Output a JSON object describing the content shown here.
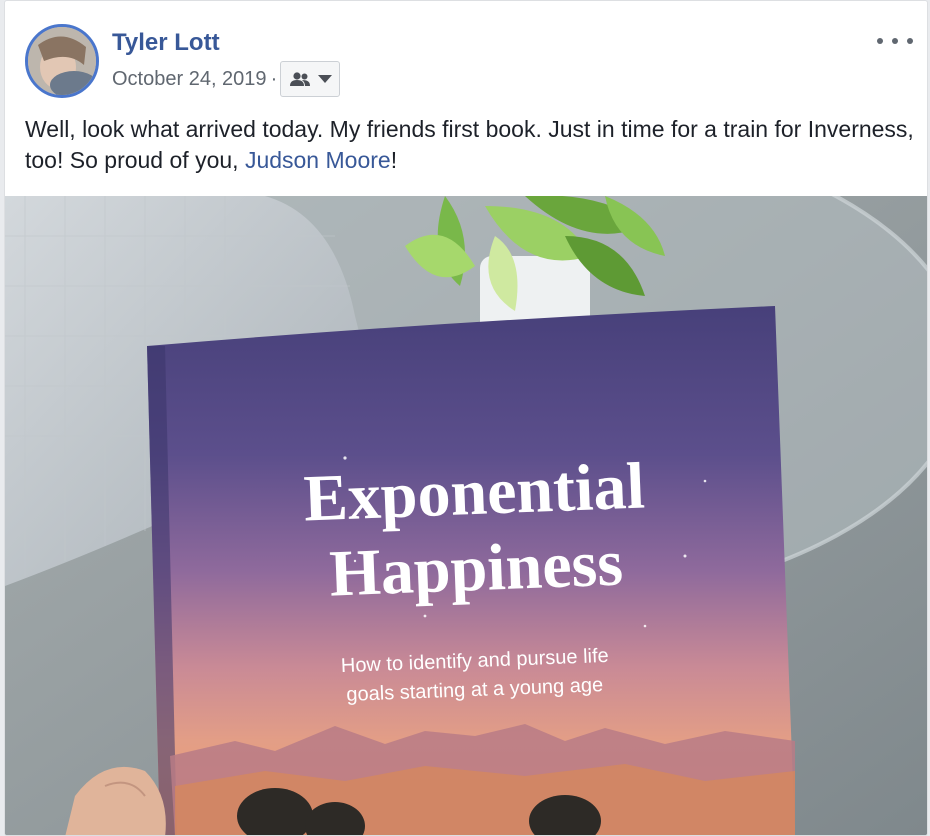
{
  "post": {
    "author": "Tyler Lott",
    "date": "October 24, 2019",
    "separator": "·",
    "message_text": "Well, look what arrived today. My friends first book. Just in time for a train for Inverness, too! So proud of you, ",
    "mention": "Judson Moore",
    "message_end": "!"
  },
  "photo": {
    "book_title_line1": "Exponential",
    "book_title_line2": "Happiness",
    "book_subtitle_line1": "How to identify and pursue life",
    "book_subtitle_line2": "goals starting at a young age"
  },
  "icons": {
    "audience": "friends-icon",
    "dropdown": "caret-down-icon",
    "more": "more-options-icon"
  },
  "colors": {
    "link": "#385898",
    "text": "#1d2129",
    "meta": "#606770",
    "avatar_ring": "#4a76cc"
  }
}
